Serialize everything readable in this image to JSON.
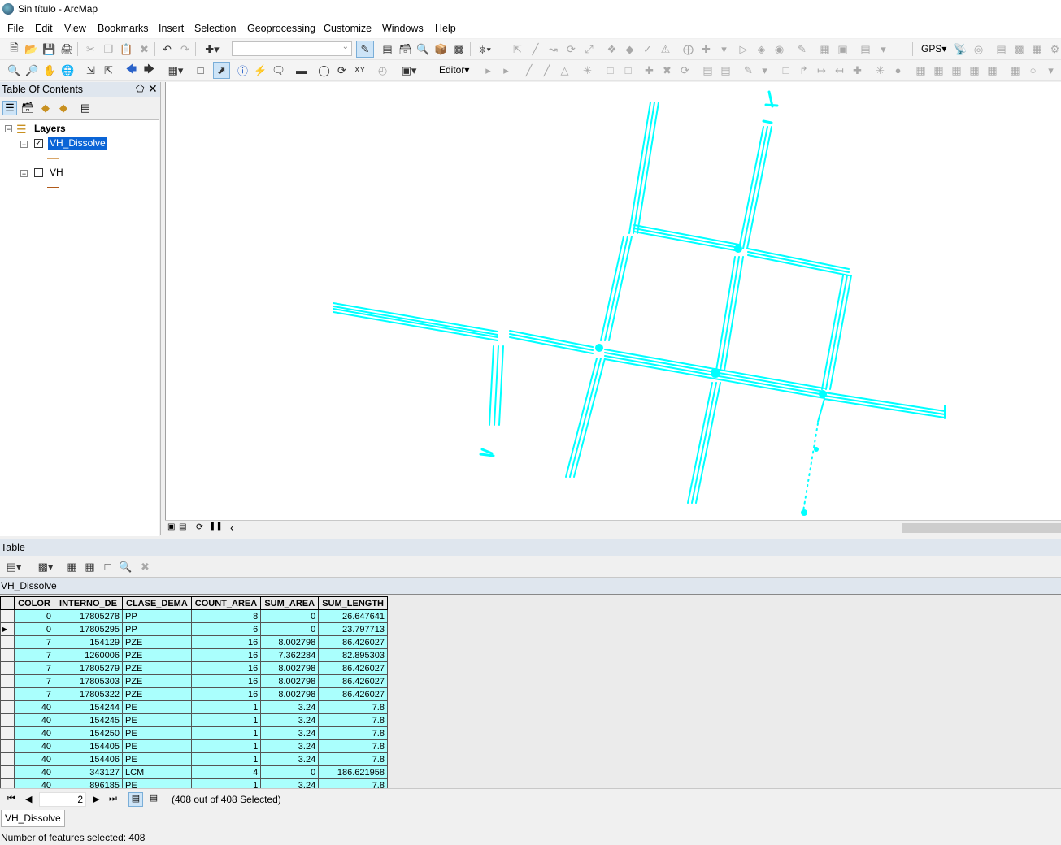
{
  "window": {
    "title": "Sin título - ArcMap"
  },
  "menu": [
    "File",
    "Edit",
    "View",
    "Bookmarks",
    "Insert",
    "Selection",
    "Geoprocessing",
    "Customize",
    "Windows",
    "Help"
  ],
  "toolbar": {
    "gps_label": "GPS",
    "editor_label": "Editor"
  },
  "toc": {
    "title": "Table Of Contents",
    "root_label": "Layers",
    "layers": [
      {
        "name": "VH_Dissolve",
        "checked": true,
        "selected": true,
        "symbol_color": "#d8a66a"
      },
      {
        "name": "VH",
        "checked": false,
        "selected": false,
        "symbol_color": "#b05a1a"
      }
    ]
  },
  "map": {
    "feature_color": "#00ffff"
  },
  "table": {
    "title": "Table",
    "layer_tab": "VH_Dissolve",
    "columns": [
      "COLOR",
      "INTERNO_DE",
      "CLASE_DEMA",
      "COUNT_AREA",
      "SUM_AREA",
      "SUM_LENGTH"
    ],
    "rows": [
      [
        "0",
        "17805278",
        "PP",
        "8",
        "0",
        "26.647641"
      ],
      [
        "0",
        "17805295",
        "PP",
        "6",
        "0",
        "23.797713"
      ],
      [
        "7",
        "154129",
        "PZE",
        "16",
        "8.002798",
        "86.426027"
      ],
      [
        "7",
        "1260006",
        "PZE",
        "16",
        "7.362284",
        "82.895303"
      ],
      [
        "7",
        "17805279",
        "PZE",
        "16",
        "8.002798",
        "86.426027"
      ],
      [
        "7",
        "17805303",
        "PZE",
        "16",
        "8.002798",
        "86.426027"
      ],
      [
        "7",
        "17805322",
        "PZE",
        "16",
        "8.002798",
        "86.426027"
      ],
      [
        "40",
        "154244",
        "PE",
        "1",
        "3.24",
        "7.8"
      ],
      [
        "40",
        "154245",
        "PE",
        "1",
        "3.24",
        "7.8"
      ],
      [
        "40",
        "154250",
        "PE",
        "1",
        "3.24",
        "7.8"
      ],
      [
        "40",
        "154405",
        "PE",
        "1",
        "3.24",
        "7.8"
      ],
      [
        "40",
        "154406",
        "PE",
        "1",
        "3.24",
        "7.8"
      ],
      [
        "40",
        "343127",
        "LCM",
        "4",
        "0",
        "186.621958"
      ],
      [
        "40",
        "896185",
        "PE",
        "1",
        "3.24",
        "7.8"
      ]
    ],
    "current_record": "2",
    "selection_text": "(408 out of 408 Selected)",
    "tab_label": "VH_Dissolve"
  },
  "status": {
    "text": "Number of features selected: 408"
  }
}
